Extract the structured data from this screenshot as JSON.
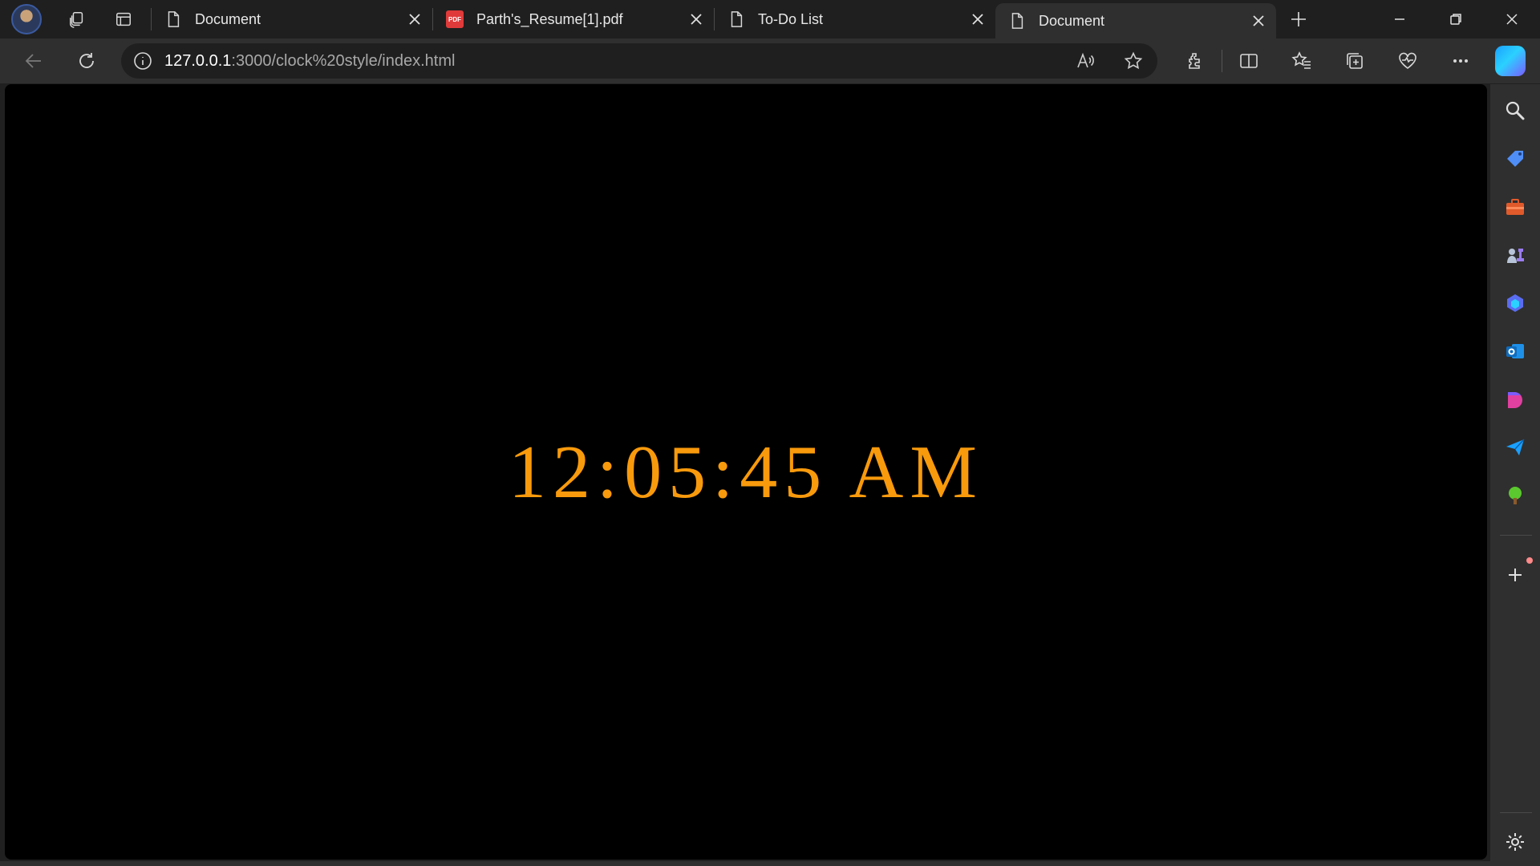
{
  "browser": {
    "tabs": [
      {
        "label": "Document",
        "icon": "page-icon",
        "active": false
      },
      {
        "label": "Parth's_Resume[1].pdf",
        "icon": "pdf-icon",
        "active": false
      },
      {
        "label": "To-Do List",
        "icon": "page-icon",
        "active": false
      },
      {
        "label": "Document",
        "icon": "page-icon",
        "active": true
      }
    ],
    "address": {
      "host": "127.0.0.1",
      "rest": ":3000/clock%20style/index.html"
    },
    "pdf_badge": "PDF"
  },
  "page": {
    "clock_text": "12:05:45 AM",
    "clock_color": "#f89a0c",
    "background": "#000000"
  },
  "sidebar": {
    "items": [
      "search-icon",
      "shopping-tag-icon",
      "toolbox-icon",
      "games-icon",
      "copilot-icon",
      "outlook-icon",
      "designer-icon",
      "send-icon",
      "tree-icon",
      "add-icon",
      "settings-icon"
    ]
  }
}
